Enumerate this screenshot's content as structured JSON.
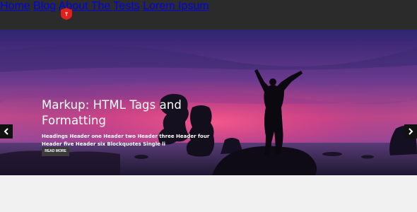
{
  "nav": {
    "items": [
      {
        "label": "Home"
      },
      {
        "label": "Blog"
      },
      {
        "label": "About The Tests"
      },
      {
        "label": "Lorem Ipsum"
      }
    ]
  },
  "hero": {
    "title": "Markup: HTML Tags and Formatting",
    "excerpt": "Headings Header one Header two Header three Header four Header five Header six Blockquotes Single li",
    "read_more": "READ MORE"
  },
  "colors": {
    "topbar": "#2b2b2b",
    "logo": "#e0201c",
    "sky_top": "#3a2a7a",
    "sky_glow": "#e0407a",
    "button": "#3a3a3a"
  },
  "icons": {
    "prev": "chevron-left-icon",
    "next": "chevron-right-icon",
    "logo": "logo-icon"
  }
}
